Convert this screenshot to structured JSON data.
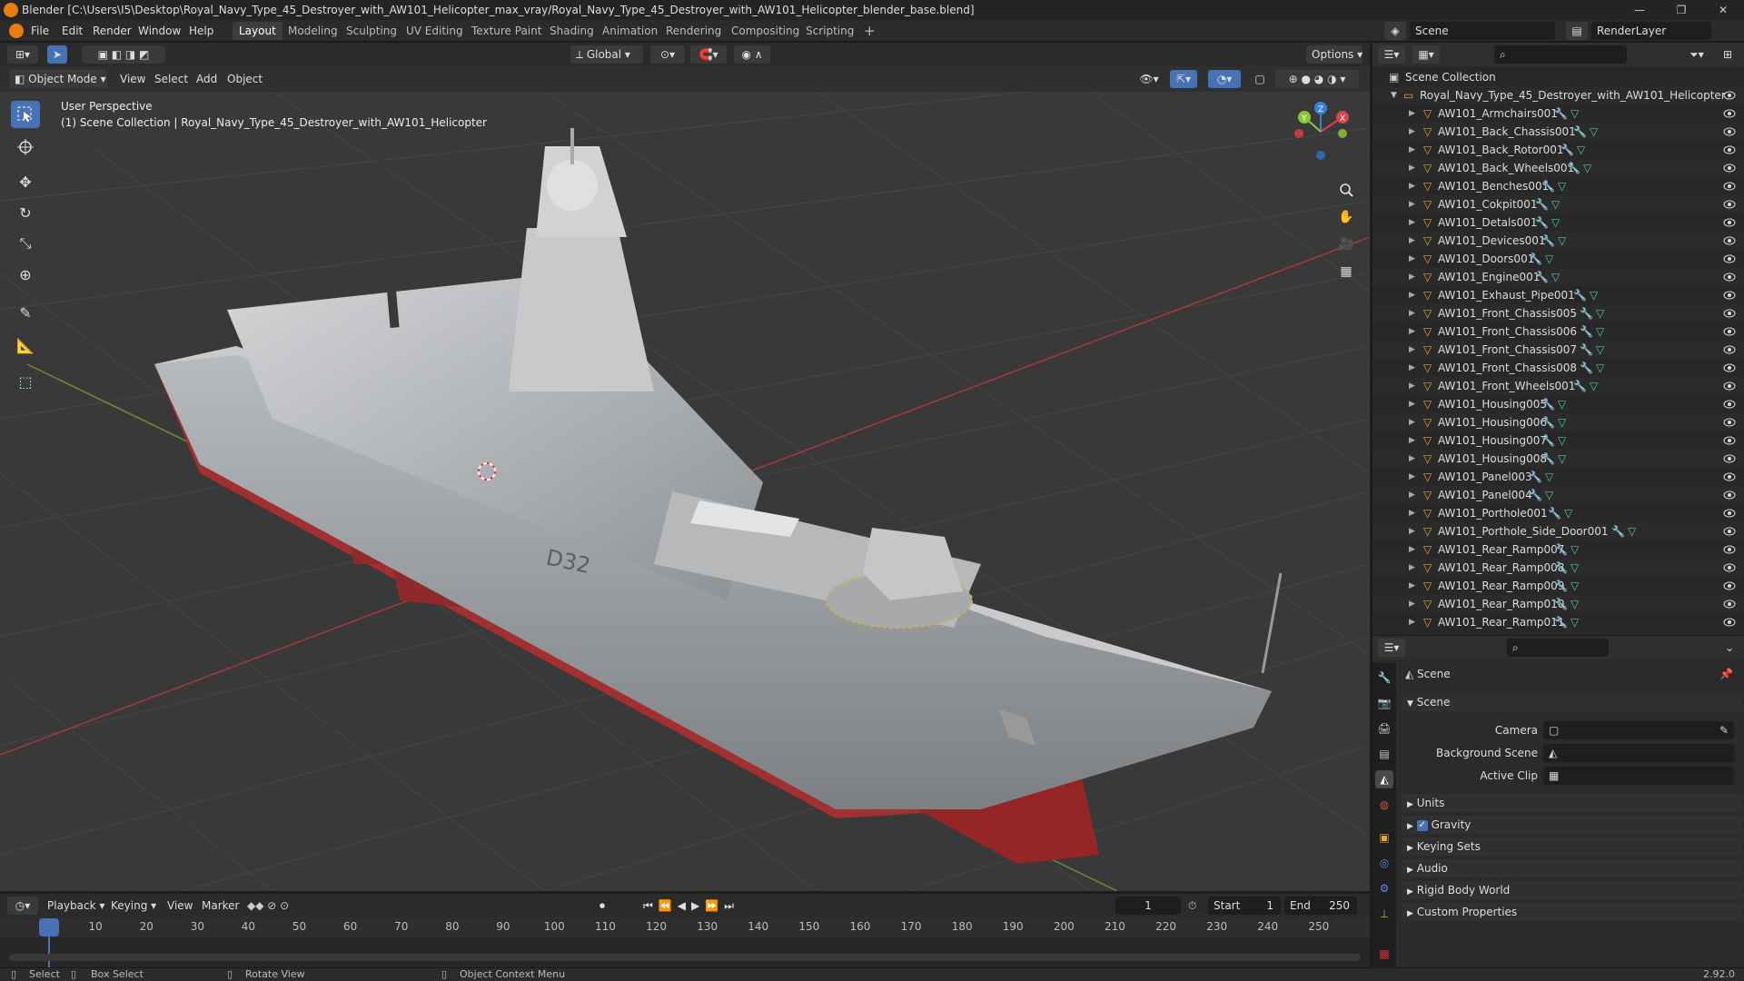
{
  "window": {
    "title": "Blender [C:\\Users\\I5\\Desktop\\Royal_Navy_Type_45_Destroyer_with_AW101_Helicopter_max_vray/Royal_Navy_Type_45_Destroyer_with_AW101_Helicopter_blender_base.blend]"
  },
  "menu": [
    "File",
    "Edit",
    "Render",
    "Window",
    "Help"
  ],
  "workspaces": [
    "Layout",
    "Modeling",
    "Sculpting",
    "UV Editing",
    "Texture Paint",
    "Shading",
    "Animation",
    "Rendering",
    "Compositing",
    "Scripting"
  ],
  "topright": {
    "scene": "Scene",
    "render_layer": "RenderLayer"
  },
  "viewport_header": {
    "transform": "Global",
    "options": "Options",
    "mode": "Object Mode",
    "menus": [
      "View",
      "Select",
      "Add",
      "Object"
    ]
  },
  "viewport": {
    "perspective": "User Perspective",
    "collection_info": "(1) Scene Collection | Royal_Navy_Type_45_Destroyer_with_AW101_Helicopter",
    "hull_number": "D32",
    "gizmo": {
      "x": "X",
      "y": "Y",
      "z": "Z"
    }
  },
  "outliner": {
    "root": "Scene Collection",
    "collection": "Royal_Navy_Type_45_Destroyer_with_AW101_Helicopter",
    "items": [
      "AW101_Armchairs001",
      "AW101_Back_Chassis001",
      "AW101_Back_Rotor001",
      "AW101_Back_Wheels001",
      "AW101_Benches001",
      "AW101_Cokpit001",
      "AW101_Detals001",
      "AW101_Devices001",
      "AW101_Doors001",
      "AW101_Engine001",
      "AW101_Exhaust_Pipe001",
      "AW101_Front_Chassis005",
      "AW101_Front_Chassis006",
      "AW101_Front_Chassis007",
      "AW101_Front_Chassis008",
      "AW101_Front_Wheels001",
      "AW101_Housing005",
      "AW101_Housing006",
      "AW101_Housing007",
      "AW101_Housing008",
      "AW101_Panel003",
      "AW101_Panel004",
      "AW101_Porthole001",
      "AW101_Porthole_Side_Door001",
      "AW101_Rear_Ramp007",
      "AW101_Rear_Ramp008",
      "AW101_Rear_Ramp009",
      "AW101_Rear_Ramp010",
      "AW101_Rear_Ramp011"
    ]
  },
  "properties": {
    "context": "Scene",
    "panel": "Scene",
    "camera_label": "Camera",
    "background_label": "Background Scene",
    "clip_label": "Active Clip",
    "sections": [
      "Units",
      "Gravity",
      "Keying Sets",
      "Audio",
      "Rigid Body World",
      "Custom Properties"
    ]
  },
  "timeline": {
    "menus": [
      "Playback",
      "Keying",
      "View",
      "Marker"
    ],
    "current_frame": "1",
    "start_label": "Start",
    "start": "1",
    "end_label": "End",
    "end": "250",
    "ticks": [
      "1",
      "10",
      "20",
      "30",
      "40",
      "50",
      "60",
      "70",
      "80",
      "90",
      "100",
      "110",
      "120",
      "130",
      "140",
      "150",
      "160",
      "170",
      "180",
      "190",
      "200",
      "210",
      "220",
      "230",
      "240",
      "250"
    ]
  },
  "status": {
    "select": "Select",
    "box_select": "Box Select",
    "rotate": "Rotate View",
    "context_menu": "Object Context Menu",
    "version": "2.92.0"
  },
  "colors": {
    "accent": "#4772b3",
    "blender_orange": "#e87d0d",
    "x_axis": "#d9434b",
    "y_axis": "#8cc43a",
    "z_axis": "#3c7fd9"
  }
}
